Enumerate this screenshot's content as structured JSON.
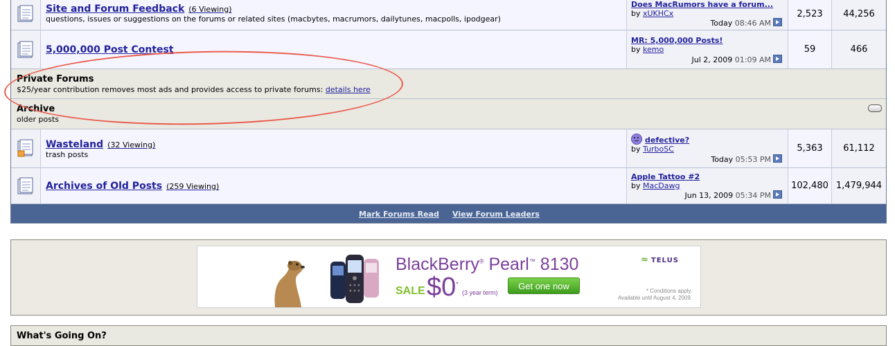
{
  "forums": [
    {
      "name": "Site and Forum Feedback",
      "viewing": "(6 Viewing)",
      "description": "questions, issues or suggestions on the forums or related sites (macbytes, macrumors, dailytunes, macpolls, ipodgear)",
      "last_post": {
        "title": "Does MacRumors have a forum...",
        "by": "by",
        "user": "xUKHCx",
        "date": "Today",
        "time": "08:46 AM"
      },
      "threads": "2,523",
      "posts": "44,256"
    },
    {
      "name": "5,000,000 Post Contest",
      "viewing": "",
      "description": "",
      "last_post": {
        "title": "MR: 5,000,000 Posts!",
        "by": "by",
        "user": "kemo",
        "date": "Jul 2, 2009",
        "time": "01:09 AM"
      },
      "threads": "59",
      "posts": "466"
    }
  ],
  "private_forums": {
    "title": "Private Forums",
    "description": "$25/year contribution removes most ads and provides access to private forums:",
    "link": "details here"
  },
  "archive": {
    "title": "Archive",
    "description": "older posts",
    "forums": [
      {
        "name": "Wasteland",
        "viewing": "(32 Viewing)",
        "description": "trash posts",
        "last_post": {
          "title": "defective?",
          "by": "by",
          "user": "TurboSC",
          "date": "Today",
          "time": "05:53 PM",
          "icon": "sad-emote-icon"
        },
        "threads": "5,363",
        "posts": "61,112"
      },
      {
        "name": "Archives of Old Posts",
        "viewing": "(259 Viewing)",
        "description": "",
        "last_post": {
          "title": "Apple Tattoo #2",
          "by": "by",
          "user": "MacDawg",
          "date": "Jun 13, 2009",
          "time": "05:34 PM"
        },
        "threads": "102,480",
        "posts": "1,479,944"
      }
    ]
  },
  "footer_links": {
    "mark_read": "Mark Forums Read",
    "leaders": "View Forum Leaders"
  },
  "ad": {
    "brand": "BlackBerry",
    "reg": "®",
    "model": "Pearl",
    "tm": "™",
    "number": "8130",
    "sale": "SALE",
    "price": "$0",
    "price_mark": "*",
    "term": "(3 year term)",
    "cta": "Get one now",
    "carrier": "TELUS",
    "fine_1": "* Conditions apply.",
    "fine_2": "Available until August 4, 2009."
  },
  "whats_going_on": "What's Going On?",
  "colors": {
    "link": "#22229c",
    "footer_bar": "#4a6494",
    "category_bg": "#e9e8e1",
    "highlight_ring": "#ea5a4a",
    "ad_purple": "#7a3f9a",
    "ad_green": "#7fbf2a"
  }
}
